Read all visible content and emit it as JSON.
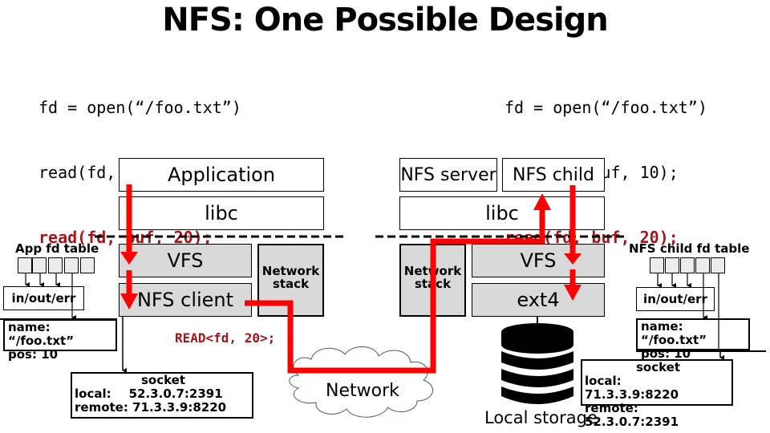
{
  "title": "NFS: One Possible Design",
  "client_code": {
    "line1": "fd = open(“/foo.txt”)",
    "line2": "read(fd, buf, 10);",
    "line3": "read(fd, buf, 20);"
  },
  "server_code": {
    "line1": "fd = open(“/foo.txt”)",
    "line2": "read(fd, buf, 10);",
    "line3": "read(fd, buf, 20);"
  },
  "client": {
    "application": "Application",
    "libc": "libc",
    "vfs": "VFS",
    "nfs_client": "NFS client",
    "network_stack_line1": "Network",
    "network_stack_line2": "stack",
    "fd_table_label": "App fd table",
    "in_out_err": "in/out/err",
    "file_name": "name: “/foo.txt”",
    "file_pos": "pos: 10",
    "socket": {
      "title": "socket",
      "local_label": "local:",
      "local_value": "52.3.0.7:2391",
      "remote_label": "remote:",
      "remote_value": "71.3.3.9:8220"
    }
  },
  "server": {
    "nfs_server": "NFS server",
    "nfs_child": "NFS child",
    "libc": "libc",
    "vfs": "VFS",
    "ext4": "ext4",
    "network_stack_line1": "Network",
    "network_stack_line2": "stack",
    "fd_table_label": "NFS child fd table",
    "in_out_err": "in/out/err",
    "file_name": "name: “/foo.txt”",
    "file_pos": "pos: 10",
    "local_storage": "Local storage",
    "socket": {
      "title": "socket",
      "local_label": "local:",
      "local_value": "71.3.3.9:8220",
      "remote_label": "remote:",
      "remote_value": "52.3.0.7:2391"
    }
  },
  "rpc_message": "READ<fd, 20>;",
  "network_label": "Network",
  "colors": {
    "flow_arrow": "#ff0000",
    "highlight_code": "#a3161b",
    "kernel_box": "#d9d9d9"
  }
}
